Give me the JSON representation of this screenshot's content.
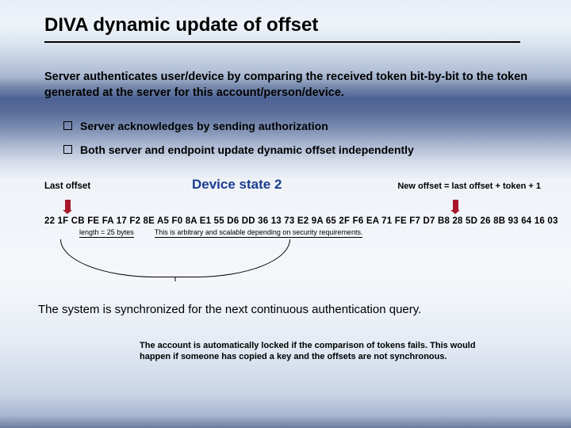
{
  "title": "DIVA dynamic update of offset",
  "intro": "Server authenticates user/device by comparing the received token bit-by-bit to the token generated at the server for this account/person/device.",
  "bullets": [
    "Server acknowledges by sending authorization",
    "Both server and endpoint update dynamic offset independently"
  ],
  "labels": {
    "last_offset": "Last offset",
    "device_state": "Device state 2",
    "new_offset": "New offset = last offset + token + 1"
  },
  "hex": "22 1F CB FE FA 17 F2 8E A5 F0 8A E1 55 D6 DD 36 13 73 E2 9A 65 2F F6 EA 71 FE F7 D7 B8 28 5D 26 8B 93 64 16 03",
  "annotations": {
    "length": "length = 25 bytes",
    "arbitrary": "This is arbitrary and scalable depending on security requirements."
  },
  "sync": "The system is synchronized for the next continuous authentication query.",
  "footer": "The account is automatically locked if the comparison of tokens fails. This would happen if someone has copied a key and the offsets are not synchronous."
}
